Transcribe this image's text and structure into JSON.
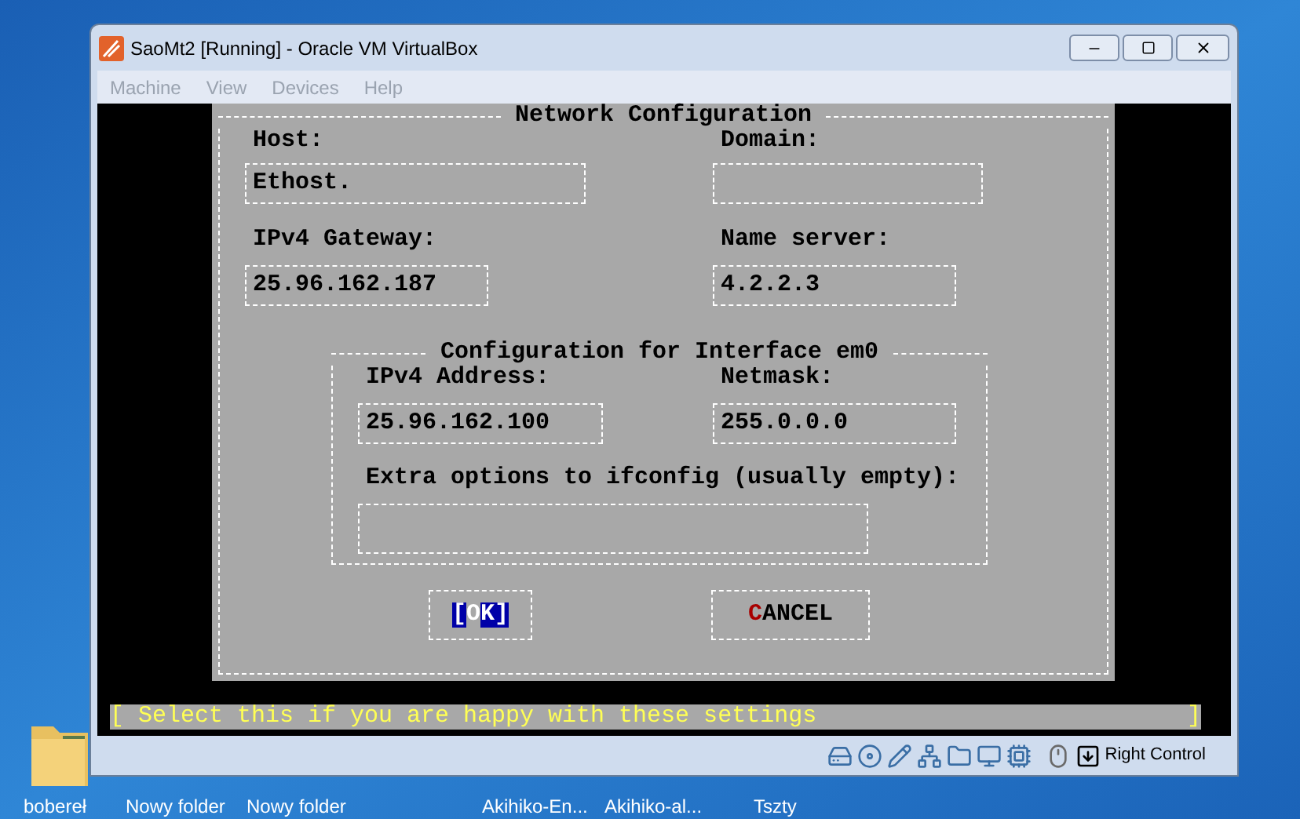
{
  "window": {
    "title": "SaoMt2 [Running] - Oracle VM VirtualBox"
  },
  "menu": [
    {
      "label": "Machine",
      "disabled": true
    },
    {
      "label": "View",
      "disabled": true
    },
    {
      "label": "Devices",
      "disabled": true
    },
    {
      "label": "Help",
      "disabled": true
    }
  ],
  "dialog": {
    "title": "Network Configuration",
    "fields": [
      {
        "label": "Host:",
        "value": "Ethost."
      },
      {
        "label": "Domain:"
      },
      {
        "label": "IPv4 Gateway:",
        "value": "25.96.162.187"
      },
      {
        "label": "Name server:",
        "value": "4.2.2.3"
      }
    ],
    "interface": {
      "title": "Configuration for Interface em0",
      "fields": [
        {
          "label": "IPv4 Address:",
          "value": "25.96.162.100"
        },
        {
          "label": "Netmask:",
          "value": "255.0.0.0"
        }
      ],
      "extra": {
        "label": "Extra options to ifconfig (usually empty):"
      }
    },
    "buttons": [
      {
        "label": "OK",
        "selected": true,
        "open_mark": "[",
        "close_mark": "]"
      },
      {
        "label": "CANCEL",
        "selected": false
      }
    ]
  },
  "status_line": {
    "text": "[ Select this if you are happy with these settings",
    "end_mark": "]"
  },
  "status_bar": {
    "host_key": "Right Control"
  },
  "desktop_icons": [
    {
      "label": "bobereł"
    },
    {
      "label": "Nowy folder"
    },
    {
      "label": "Nowy folder"
    },
    {
      "label": "Akihiko-En..."
    },
    {
      "label": "Akihiko-al..."
    },
    {
      "label": "Tszty"
    }
  ]
}
